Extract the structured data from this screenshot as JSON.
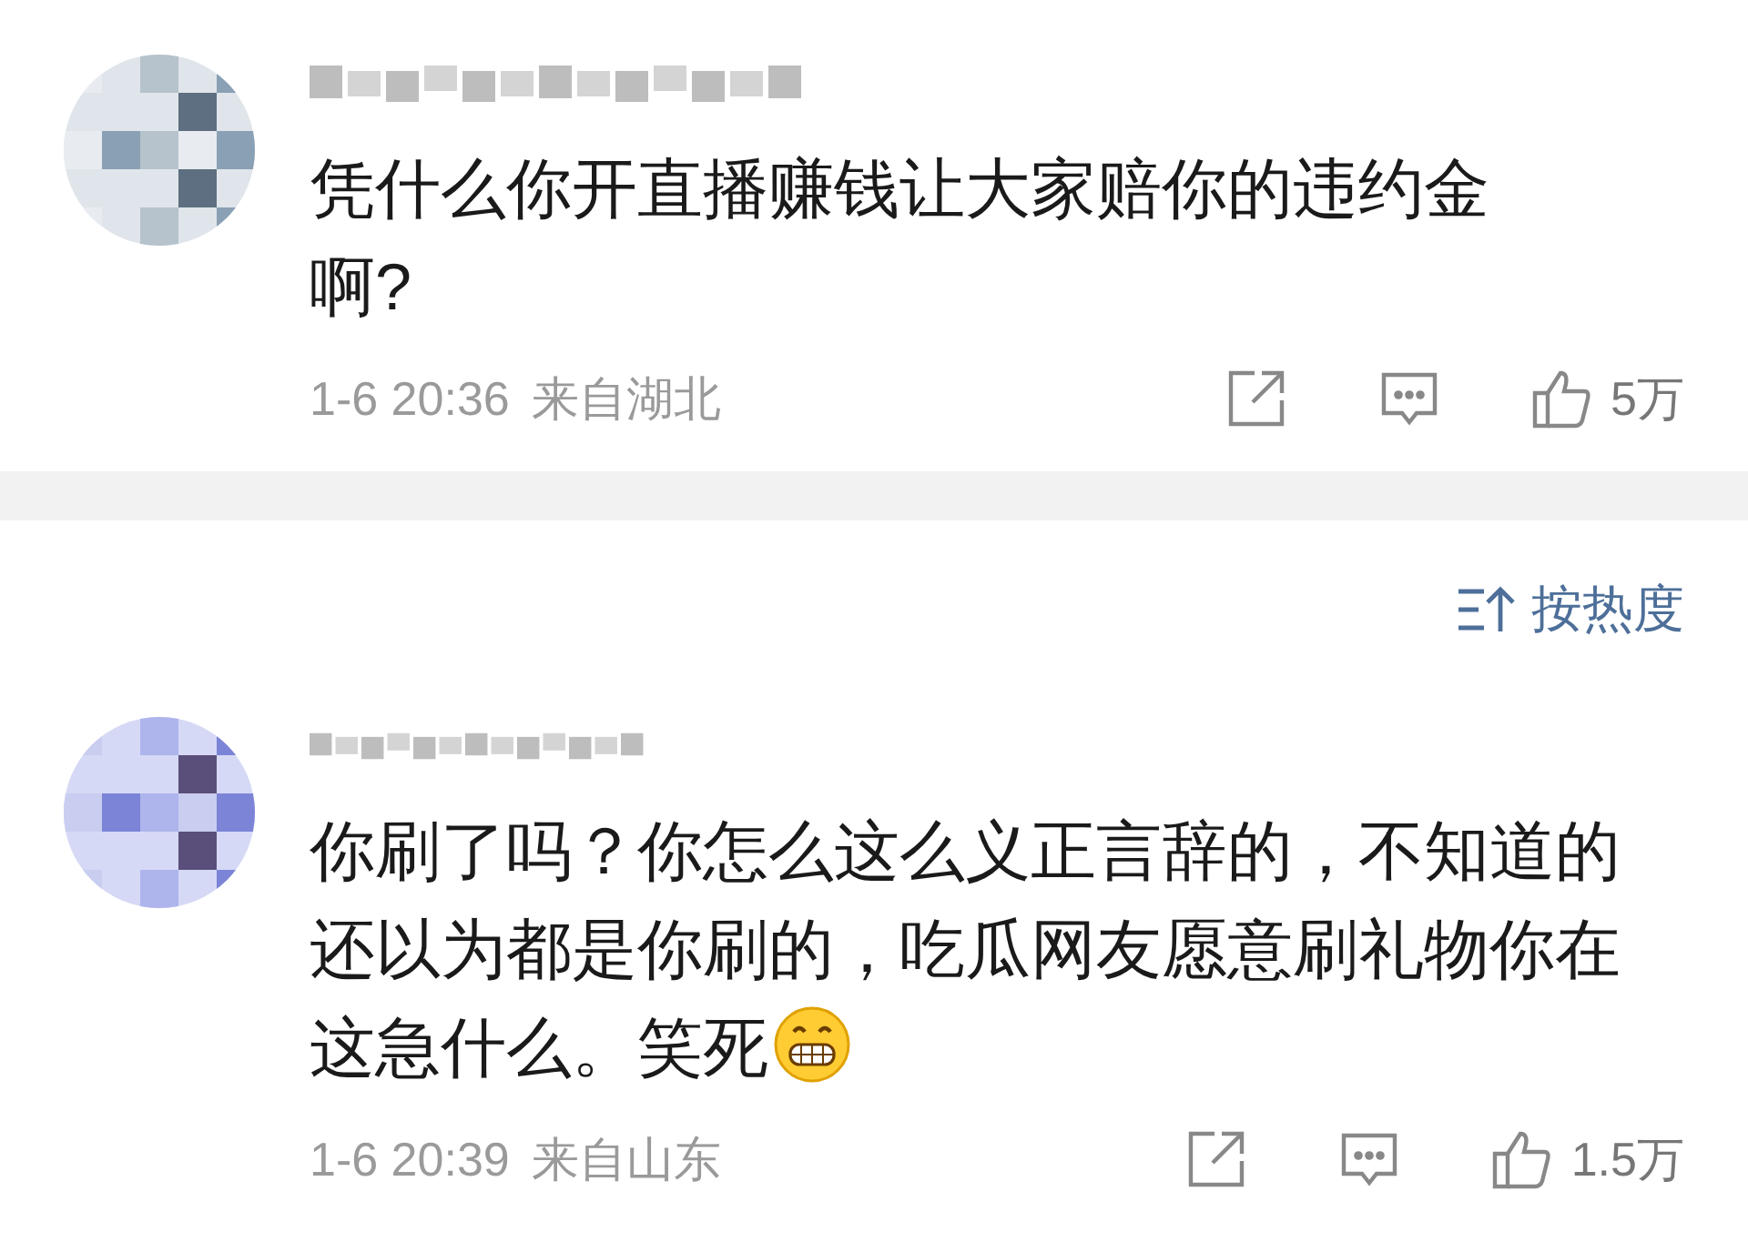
{
  "comments": [
    {
      "text_lines": [
        "凭什么你开直播赚钱让大家赔你的违约金",
        "啊?"
      ],
      "emoji": false,
      "time": "1-6 20:36",
      "location": "来自湖北",
      "likes": "5万"
    },
    {
      "text_lines": [
        "你刷了吗？你怎么这么义正言辞的，不知道的",
        "还以为都是你刷的，吃瓜网友愿意刷礼物你在",
        "这急什么。笑死"
      ],
      "emoji": true,
      "time": "1-6 20:39",
      "location": "来自山东",
      "likes": "1.5万"
    }
  ],
  "sort": {
    "label": "按热度"
  }
}
